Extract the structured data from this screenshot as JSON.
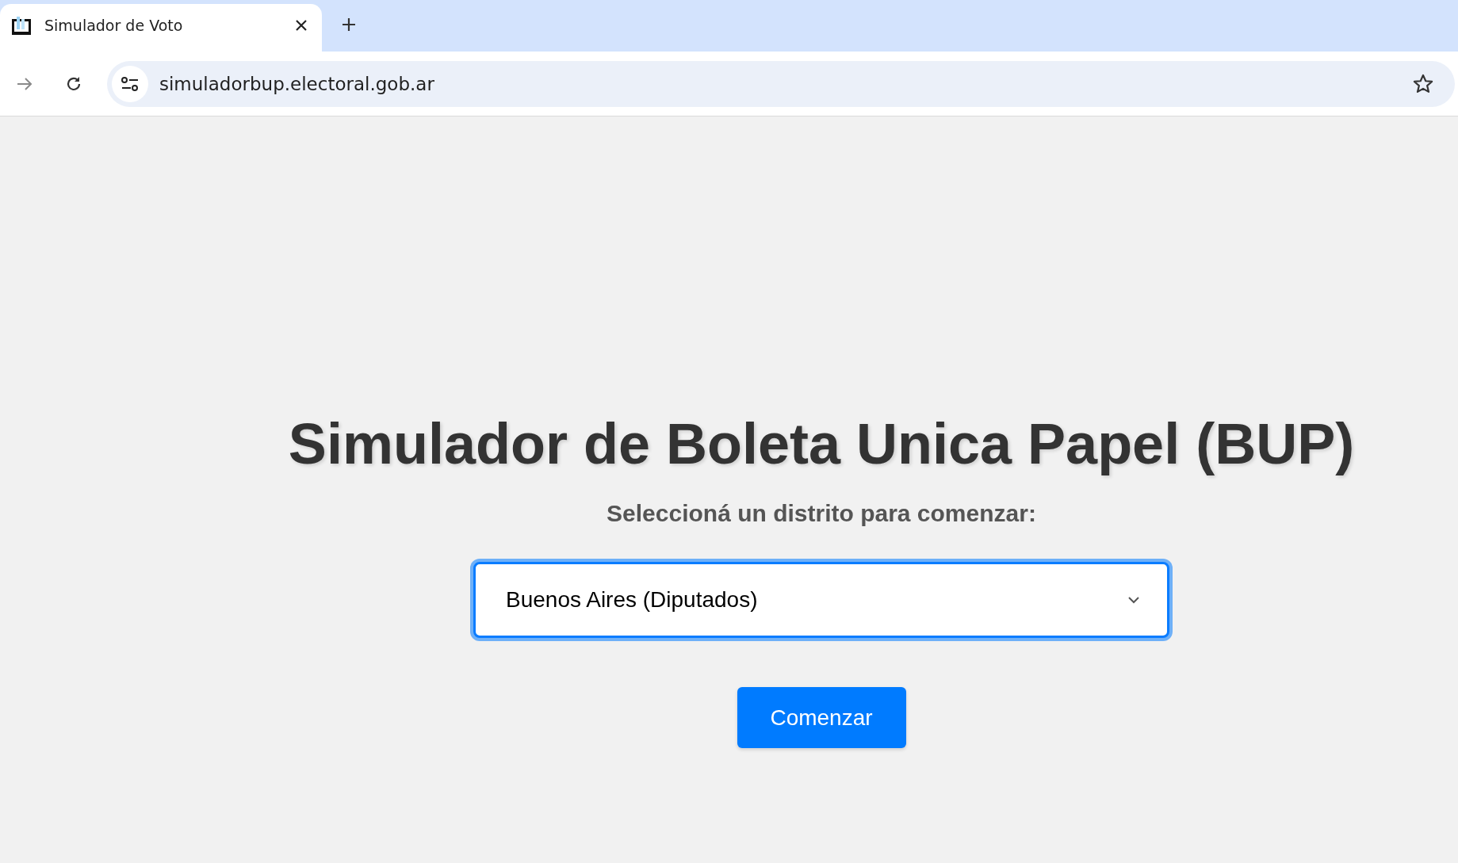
{
  "browser": {
    "tabs": [
      {
        "title": "Simulador de Voto",
        "selected": true
      }
    ],
    "address": "simuladorbup.electoral.gob.ar",
    "forward_enabled": true
  },
  "page": {
    "title": "Simulador de Boleta Unica Papel (BUP)",
    "prompt": "Seleccioná un distrito para comenzar:",
    "district_select": {
      "value": "Buenos Aires (Diputados)",
      "focused": true
    },
    "start_button": "Comenzar"
  }
}
